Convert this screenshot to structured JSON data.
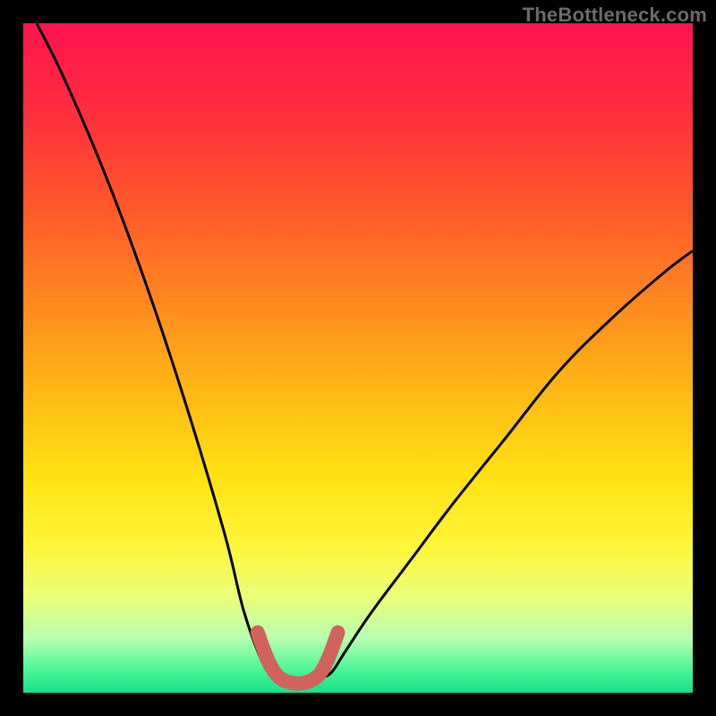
{
  "watermark": "TheBottleneck.com",
  "chart_data": {
    "type": "line",
    "title": "",
    "xlabel": "",
    "ylabel": "",
    "xlim": [
      0,
      100
    ],
    "ylim": [
      0,
      100
    ],
    "grid": false,
    "legend": false,
    "series": [
      {
        "name": "bottleneck-curve",
        "x": [
          2,
          6,
          12,
          18,
          24,
          30,
          33,
          36,
          38,
          40,
          42,
          44,
          46,
          48,
          52,
          58,
          64,
          72,
          80,
          88,
          96,
          100
        ],
        "y": [
          100,
          92,
          78,
          62,
          44,
          24,
          12,
          4,
          2,
          1,
          1,
          2,
          3,
          6,
          12,
          20,
          28,
          38,
          48,
          56,
          63,
          66
        ]
      },
      {
        "name": "optimal-range-marker",
        "x": [
          35,
          36.5,
          38,
          40,
          42,
          44,
          45.5,
          47
        ],
        "y": [
          9,
          5,
          2.5,
          1.5,
          1.5,
          2.5,
          5,
          9
        ]
      }
    ],
    "gradient_stops": [
      {
        "offset": 0.0,
        "color": "#ff1450"
      },
      {
        "offset": 0.12,
        "color": "#ff2a3f"
      },
      {
        "offset": 0.28,
        "color": "#ff5a2a"
      },
      {
        "offset": 0.42,
        "color": "#ff8a1e"
      },
      {
        "offset": 0.55,
        "color": "#ffb814"
      },
      {
        "offset": 0.68,
        "color": "#ffe313"
      },
      {
        "offset": 0.78,
        "color": "#fff53a"
      },
      {
        "offset": 0.86,
        "color": "#eaff7a"
      },
      {
        "offset": 0.92,
        "color": "#b6ffb0"
      },
      {
        "offset": 0.965,
        "color": "#4cf598"
      },
      {
        "offset": 1.0,
        "color": "#18e08c"
      }
    ],
    "marker_color": "#d1625d",
    "curve_color": "#000000"
  }
}
